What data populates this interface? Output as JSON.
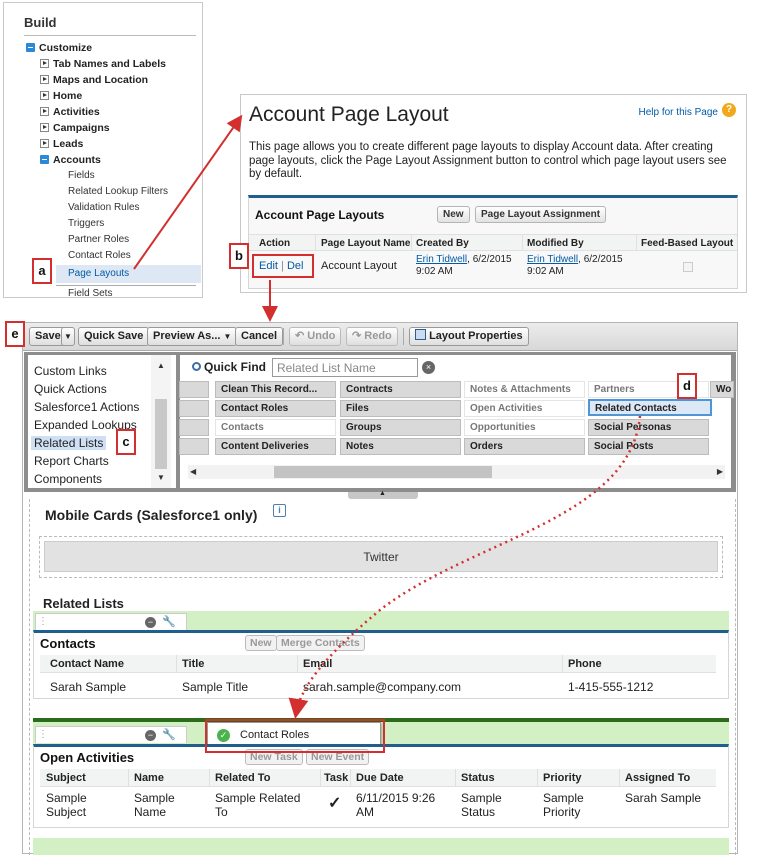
{
  "build": {
    "title": "Build",
    "customize": "Customize",
    "items": [
      "Tab Names and Labels",
      "Maps and Location",
      "Home",
      "Activities",
      "Campaigns",
      "Leads"
    ],
    "accounts": "Accounts",
    "account_items": [
      "Fields",
      "Related Lookup Filters",
      "Validation Rules",
      "Triggers",
      "Partner Roles",
      "Contact Roles"
    ],
    "page_layouts": "Page Layouts",
    "field_sets": "Field Sets"
  },
  "apl": {
    "title": "Account Page Layout",
    "help": "Help for this Page",
    "help_icon": "?",
    "desc": "This page allows you to create different page layouts to display Account data. After creating page layouts, click the Page Layout Assignment button to control which page layout users see by default.",
    "section_title": "Account Page Layouts",
    "new_btn": "New",
    "assign_btn": "Page Layout Assignment",
    "headers": [
      "Action",
      "Page Layout Name",
      "Created By",
      "Modified By",
      "Feed-Based Layout"
    ],
    "row": {
      "edit": "Edit",
      "sep": "|",
      "del": "Del",
      "name": "Account Layout",
      "created_name": "Erin Tidwell",
      "created_date": ", 6/2/2015",
      "created_time": "9:02 AM",
      "modified_name": "Erin Tidwell",
      "modified_date": ", 6/2/2015",
      "modified_time": "9:02 AM"
    }
  },
  "toolbar": {
    "save": "Save",
    "quick_save": "Quick Save",
    "preview": "Preview As...",
    "cancel": "Cancel",
    "undo": "Undo",
    "redo": "Redo",
    "layout_props": "Layout Properties"
  },
  "palette": {
    "categories": [
      "Custom Links",
      "Quick Actions",
      "Salesforce1 Actions",
      "Expanded Lookups",
      "Related Lists",
      "Report Charts",
      "Components"
    ],
    "quick_find_label": "Quick Find",
    "quick_find_placeholder": "Related List Name",
    "clear_icon": "×",
    "fields_row1": [
      "Clean This Record...",
      "Contracts",
      "Notes & Attachments",
      "Partners",
      "Wo"
    ],
    "fields_row2": [
      "Contact Roles",
      "Files",
      "Open Activities",
      "Related Contacts"
    ],
    "fields_row3": [
      "Contacts",
      "Groups",
      "Opportunities",
      "Social Personas"
    ],
    "fields_row4": [
      "Content Deliveries",
      "Notes",
      "Orders",
      "Social Posts"
    ]
  },
  "canvas": {
    "mobile_title": "Mobile Cards (Salesforce1 only)",
    "info_icon": "i",
    "twitter": "Twitter",
    "related_title": "Related Lists",
    "contacts": {
      "title": "Contacts",
      "new_btn": "New",
      "merge_btn": "Merge Contacts",
      "headers": [
        "Contact Name",
        "Title",
        "Email",
        "Phone"
      ],
      "row": [
        "Sarah Sample",
        "Sample Title",
        "sarah.sample@company.com",
        "1-415-555-1212"
      ]
    },
    "drag_item": "Contact Roles",
    "activities": {
      "title": "Open Activities",
      "new_task": "New Task",
      "new_event": "New Event",
      "headers": [
        "Subject",
        "Name",
        "Related To",
        "Task",
        "Due Date",
        "Status",
        "Priority",
        "Assigned To"
      ],
      "row": [
        "Sample Subject",
        "Sample Name",
        "Sample Related To",
        "✓",
        "6/11/2015 9:26 AM",
        "Sample Status",
        "Sample Priority",
        "Sarah Sample"
      ]
    }
  },
  "callouts": [
    "a",
    "b",
    "c",
    "d",
    "e"
  ],
  "colors": {
    "accent": "#1f5e8d",
    "callout": "#d32f2f",
    "link": "#015ba7",
    "related_bar": "#d3f0c5"
  }
}
